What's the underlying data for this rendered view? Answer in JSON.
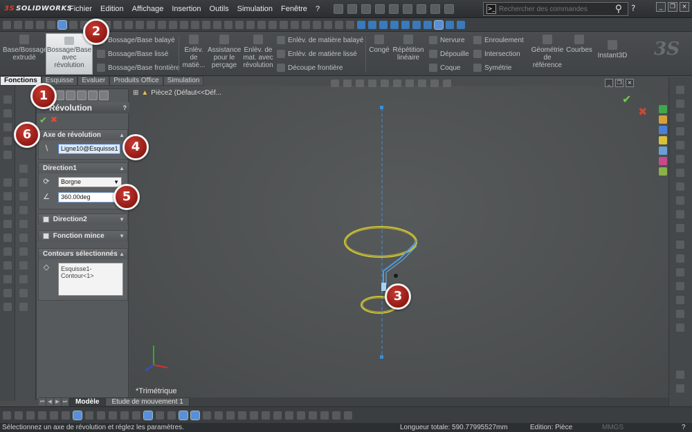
{
  "app": {
    "logo_ds": "3S",
    "logo_text": "SOLIDWORKS"
  },
  "menu": {
    "items": [
      "Fichier",
      "Edition",
      "Affichage",
      "Insertion",
      "Outils",
      "Simulation",
      "Fenêtre",
      "?"
    ]
  },
  "search": {
    "placeholder": "Rechercher des commandes"
  },
  "ribbon": {
    "base_extrude": "Base/Bossage extrudé",
    "revolve": "Bossage/Base avec révolution",
    "sweep": "Bossage/Base balayé",
    "loft": "Bossage/Base lissé",
    "boundary": "Bossage/Base frontière",
    "cut_extrude": "Enlèv. de matiè...",
    "hole_wizard": "Assistance pour le perçage",
    "cut_revolve": "Enlèv. de mat. avec révolution",
    "cut_sweep": "Enlèv. de matière balayé",
    "cut_loft": "Enlèv. de matière lissé",
    "cut_boundary": "Découpe frontière",
    "fillet": "Congé",
    "pattern": "Répétition linéaire",
    "rib": "Nervure",
    "draft": "Dépouille",
    "shell": "Coque",
    "wrap": "Enroulement",
    "intersect": "Intersection",
    "mirror": "Symétrie",
    "ref_geometry": "Géométrie de référence",
    "curves": "Courbes",
    "instant3d": "Instant3D"
  },
  "tabs": [
    "Fonctions",
    "Esquisse",
    "Evaluer",
    "Produits Office",
    "Simulation"
  ],
  "property_manager": {
    "title": "Révolution",
    "help": "? ",
    "axis_section": "Axe de révolution",
    "axis_value": "Ligne10@Esquisse1",
    "direction1_section": "Direction1",
    "end_condition": "Borgne",
    "angle_value": "360.00deg",
    "direction2_section": "Direction2",
    "thin_section": "Fonction mince",
    "contours_section": "Contours sélectionnés",
    "contours_value": "Esquisse1-Contour<1>"
  },
  "graphics": {
    "tree_node": "Pièce2  (Défaut<<Déf...",
    "view_name": "*Trimétrique"
  },
  "model_tabs": [
    "Modèle",
    "Etude de mouvement 1"
  ],
  "status": {
    "message": "Sélectionnez un axe de révolution et réglez les paramètres.",
    "length": "Longueur totale: 590.77995527mm",
    "edit": "Edition: Pièce",
    "units": "MMGS",
    "help": "?"
  },
  "steps": [
    "1",
    "2",
    "3",
    "4",
    "5",
    "6"
  ],
  "colors": {
    "accent": "#4a7fc8",
    "step_red": "#a3211a",
    "profile_yellow": "#c9c23a",
    "axis_blue": "#3a8fd8"
  }
}
